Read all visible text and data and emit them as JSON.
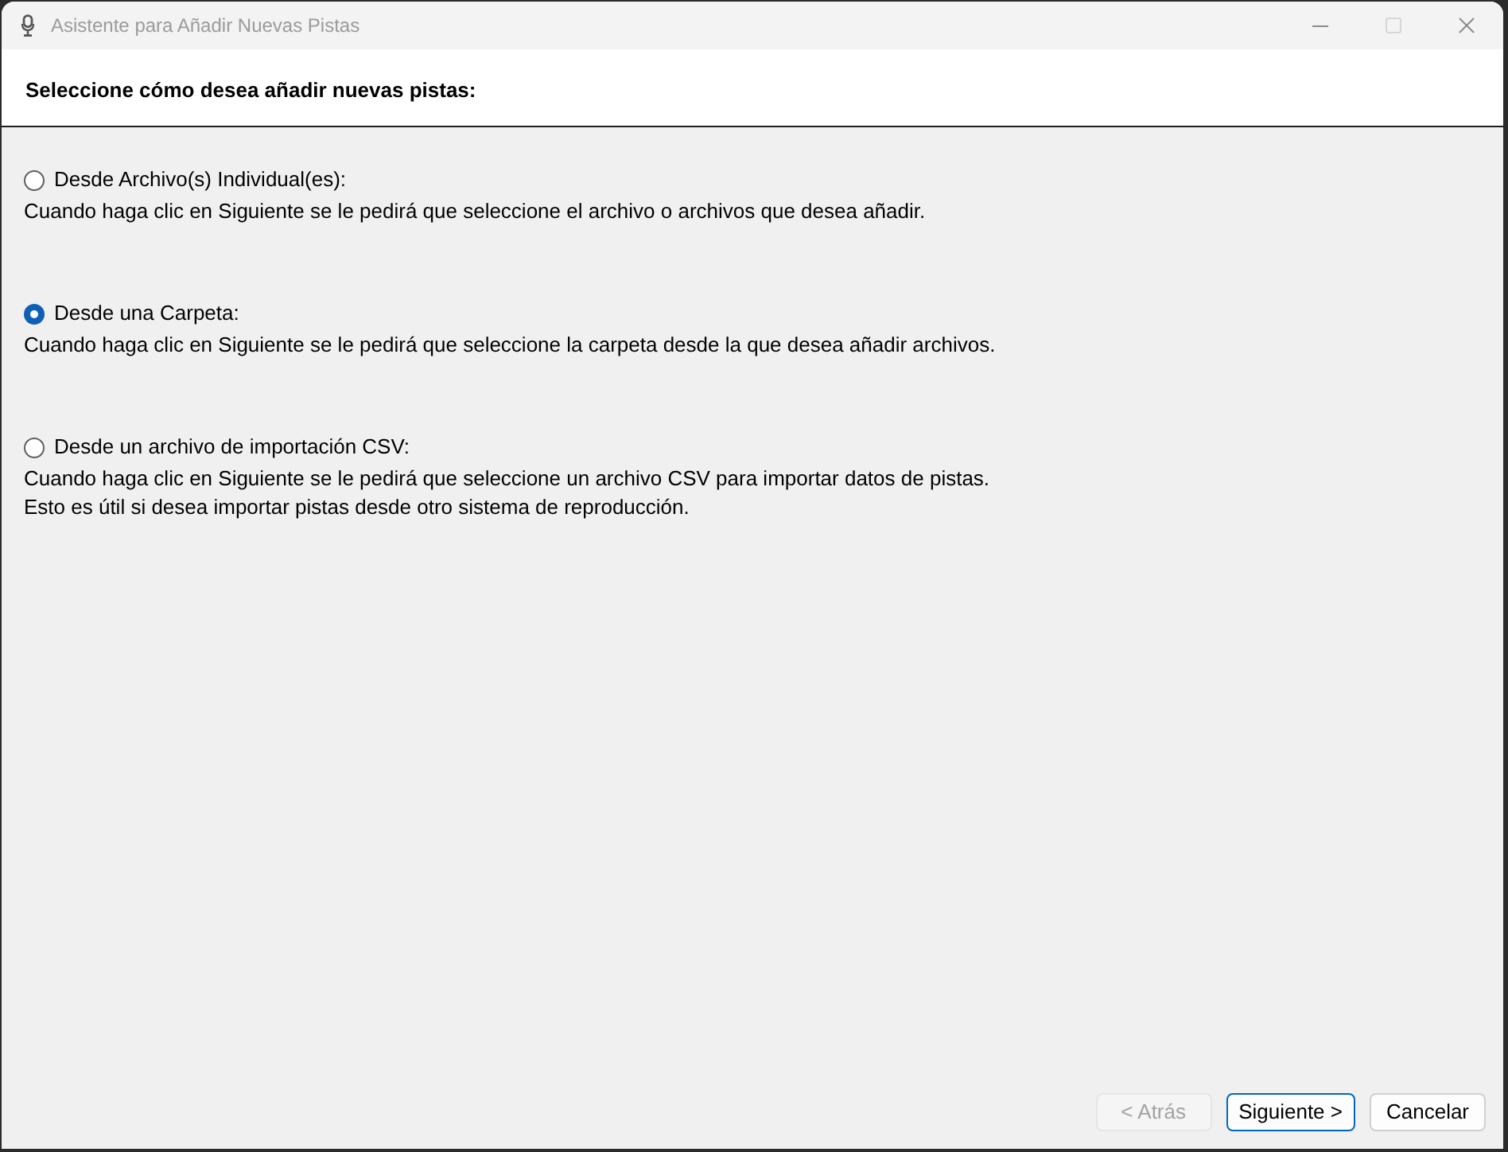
{
  "window": {
    "title": "Asistente para Añadir Nuevas Pistas",
    "controls": [
      {
        "kind": "minimize",
        "disabled": false
      },
      {
        "kind": "maximize",
        "disabled": true
      },
      {
        "kind": "close",
        "disabled": false
      }
    ]
  },
  "header": {
    "title": "Seleccione cómo desea añadir nuevas pistas:"
  },
  "options": [
    {
      "label": "Desde Archivo(s) Individual(es):",
      "selected": false,
      "description": [
        "Cuando haga clic en Siguiente se le pedirá que seleccione el archivo o archivos que desea añadir."
      ]
    },
    {
      "label": "Desde una Carpeta:",
      "selected": true,
      "description": [
        "Cuando haga clic en Siguiente se le pedirá que seleccione la carpeta desde la que desea añadir archivos."
      ]
    },
    {
      "label": "Desde un archivo de importación CSV:",
      "selected": false,
      "description": [
        "Cuando haga clic en Siguiente se le pedirá que seleccione un archivo CSV para importar datos de pistas.",
        "Esto es útil si desea importar pistas desde otro sistema de reproducción."
      ]
    }
  ],
  "buttons": [
    {
      "label": "< Atrás",
      "disabled": true,
      "default": false
    },
    {
      "label": "Siguiente >",
      "disabled": false,
      "default": true
    },
    {
      "label": "Cancelar",
      "disabled": false,
      "default": false
    }
  ]
}
